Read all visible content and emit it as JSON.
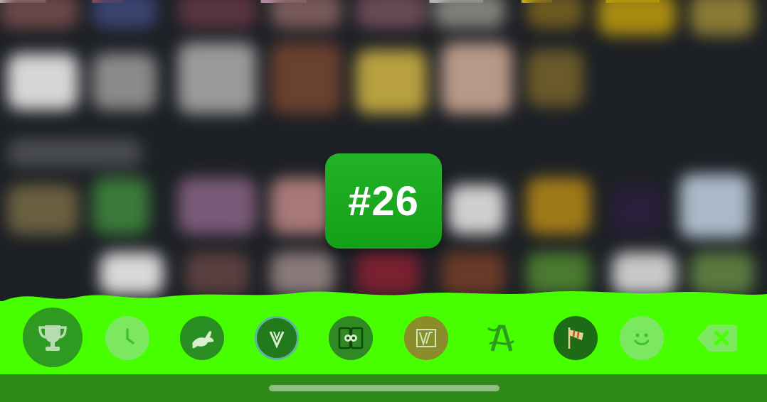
{
  "rank": {
    "label": "#26",
    "background": "#18a81d",
    "text_color": "#ffffff"
  },
  "colors": {
    "toolbar_background": "#47ff00",
    "home_area_background": "#2e8a17",
    "home_indicator": "#8fbf80",
    "selected_key": "#2f9a22"
  },
  "toolbar": {
    "selected_index": 0,
    "keys": [
      {
        "icon": "trophy-icon",
        "selected": true
      },
      {
        "icon": "clock-icon",
        "selected": false
      },
      {
        "icon": "rabbit-icon",
        "selected": false
      },
      {
        "icon": "vine-v-icon",
        "selected": false
      },
      {
        "icon": "duo-screens-icon",
        "selected": false
      },
      {
        "icon": "split-v-icon",
        "selected": false
      },
      {
        "icon": "abstract-a-icon",
        "selected": false
      },
      {
        "icon": "windsock-icon",
        "selected": false
      },
      {
        "icon": "smiley-icon",
        "selected": false
      },
      {
        "icon": "delete-key-icon",
        "selected": false
      }
    ]
  }
}
